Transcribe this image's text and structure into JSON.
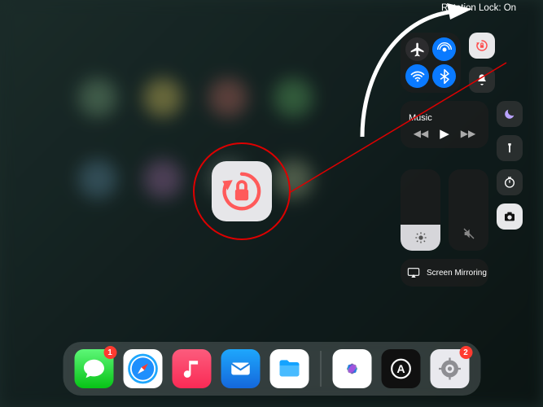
{
  "annotation": {
    "label": "Rotation Lock: On"
  },
  "control_center": {
    "connectivity": {
      "airplane": "airplane-icon",
      "airdrop": "airdrop-icon",
      "wifi": "wifi-icon",
      "bluetooth": "bluetooth-icon"
    },
    "rotation_lock_active": true,
    "music": {
      "title": "Music"
    },
    "brightness_pct": 32,
    "volume_pct": 0,
    "screen_mirroring": "Screen Mirroring"
  },
  "dock": {
    "apps": [
      {
        "name": "messages",
        "badge": "1"
      },
      {
        "name": "safari"
      },
      {
        "name": "music"
      },
      {
        "name": "mail"
      },
      {
        "name": "files"
      },
      {
        "name": "photos"
      },
      {
        "name": "a-circle"
      },
      {
        "name": "settings",
        "badge": "2"
      }
    ]
  },
  "colors": {
    "accent_red": "#ff4d4d",
    "ios_blue": "#0a7aff"
  }
}
